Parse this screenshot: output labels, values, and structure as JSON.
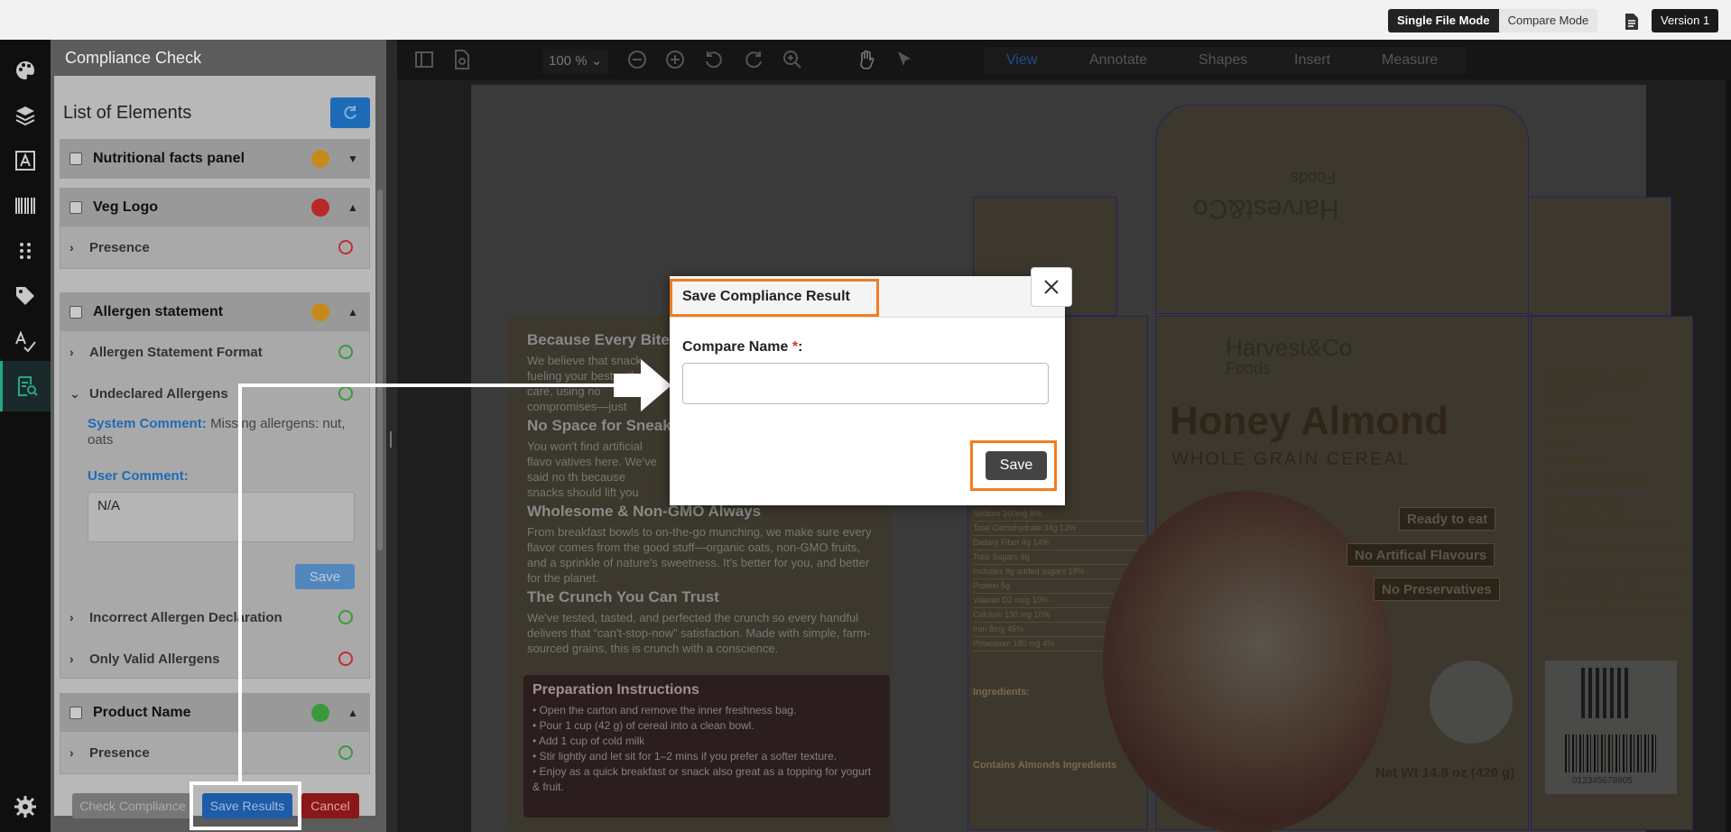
{
  "topbar": {
    "single_mode": "Single File Mode",
    "compare_mode": "Compare Mode",
    "version": "Version 1"
  },
  "rail": {
    "icons": [
      "palette-icon",
      "layers-icon",
      "text-icon",
      "barcode-icon",
      "grid-icon",
      "tag-icon",
      "spellcheck-icon",
      "compliance-icon",
      "settings-icon"
    ]
  },
  "panel": {
    "title": "Compliance Check",
    "list_title": "List of Elements",
    "groups": [
      {
        "name": "Nutritional facts panel",
        "status_color": "#c68a1a",
        "expanded": false
      },
      {
        "name": "Veg Logo",
        "status_color": "#b82828",
        "expanded": true,
        "items": [
          {
            "label": "Presence",
            "ring": "red"
          }
        ]
      },
      {
        "name": "Allergen statement",
        "status_color": "#c68a1a",
        "expanded": true,
        "items": [
          {
            "label": "Allergen Statement Format",
            "ring": "green"
          },
          {
            "label": "Undeclared Allergens",
            "ring": "green",
            "expanded": true
          },
          {
            "label": "Incorrect Allergen Declaration",
            "ring": "green"
          },
          {
            "label": "Only Valid Allergens",
            "ring": "red"
          }
        ],
        "system_comment_label": "System Comment:",
        "system_comment": "Missing allergens: nut, oats",
        "user_comment_label": "User Comment:",
        "user_comment": "N/A",
        "save_label": "Save"
      },
      {
        "name": "Product Name",
        "status_color": "#3a9a3a",
        "expanded": true,
        "items": [
          {
            "label": "Presence",
            "ring": "green"
          }
        ]
      }
    ],
    "buttons": {
      "check": "Check Compliance",
      "save_results": "Save Results",
      "cancel": "Cancel"
    }
  },
  "toolbar": {
    "zoom": "100 %",
    "tabs": [
      "View",
      "Annotate",
      "Shapes",
      "Insert",
      "Measure"
    ],
    "active_tab": "View"
  },
  "document": {
    "left_headings": [
      "Because Every Bite Sh",
      "No Space for Sneaky S",
      "Wholesome & Non-GMO Always",
      "The Crunch You Can Trust"
    ],
    "left_paragraphs": [
      "We believe that snack fueling your best with care, using no compromises—just",
      "You won't find artificial flavo vatives here. We've said no th because snacks should lift you",
      "From breakfast bowls to on-the-go munching, we make sure every flavor comes from the good stuff—organic oats, non-GMO fruits, and a sprinkle of nature's sweetness. It's better for you, and better for the planet.",
      "We've tested, tasted, and perfected the crunch so every handful delivers that “can't-stop-now” satisfaction. Made with simple, farm-sourced grains, this is crunch with a conscience."
    ],
    "prep_title": "Preparation Instructions",
    "prep_steps": [
      "• Open the carton and remove  the inner freshness bag.",
      "• Pour 1 cup (42 g) of cereal into a clean bowl.",
      "• Add 1 cup of cold milk",
      "• Stir lightly and let sit for 1–2 mins if you prefer a softer texture.",
      "• Enjoy as a quick breakfast or snack also great as a topping for yogurt & fruit."
    ],
    "nutrition_lines": [
      "Sodium 160mg  8%",
      "Total Carbohydrate 34g  12%",
      "Dietary Fiber 4g  14%",
      "Total Sugars 9g",
      "Includes 9g added sugars  18%",
      "Protein 5g",
      "Vitamin D2 mcg  10%",
      "Calcium 130 mg  10%",
      "Iron 8mg  45%",
      "Potassium 180 mg  4%"
    ],
    "ingredients_title": "Ingredients:",
    "contains": "Contains Almonds Ingredients",
    "brand": "Harvest&Co",
    "brand_sub": "Foods",
    "product_title": "Honey Almond",
    "product_sub": "WHOLE GRAIN CEREAL",
    "badges": [
      "Ready to eat",
      "No Artifical Flavours",
      "No Preservatives"
    ],
    "net_wt": "Net Wt 14.8 oz (420 g)",
    "side_claims": [
      "Good source of fiber",
      "Made with whole grains",
      "No Trans Fat",
      "No Artificial Colours"
    ],
    "fiber_note": "(contains 4g fiber / 14% DV per serving)",
    "address_lines": [
      "Marketing Address:",
      "Harvest & Co. Foods",
      "5 Independence Way, 3rd Floor #246,",
      "Princeton, NJ 08540, United States",
      "",
      "Customer Service: 1-800-555-0199",
      "(Mon–Fri 9am–5pm CT)",
      "Website:www.harvestcofoods.com",
      "Email:support@harvestcofoods.com"
    ],
    "barcode_number": "012345678905"
  },
  "modal": {
    "title": "Save Compliance Result",
    "field_label": "Compare Name",
    "required_mark": "*",
    "colon": ":",
    "input_value": "",
    "save_label": "Save"
  },
  "colors": {
    "accent_orange": "#ef7d22",
    "primary_blue": "#1e6bb8"
  }
}
